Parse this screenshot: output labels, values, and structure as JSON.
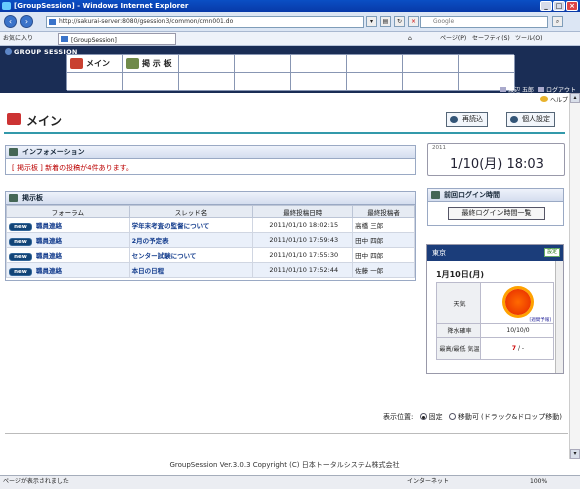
{
  "browser": {
    "window_title": "[GroupSession] - Windows Internet Explorer",
    "address": "http://sakurai-server:8080/gsession3/common/cmn001.do",
    "search_placeholder": "Google",
    "favorites_label": "お気に入り",
    "tab_title": "[GroupSession]",
    "toolbar_page": "ページ(P)",
    "toolbar_safety": "セーフティ(S)",
    "toolbar_tools": "ツール(O)",
    "status_text": "ページが表示されました",
    "zone": "インターネット",
    "zoom": "100%"
  },
  "header": {
    "logo": "GROUP SESSION",
    "menu": [
      {
        "label": "メイン",
        "icon": "main-icon"
      },
      {
        "label": "掲 示 板",
        "icon": "bbs-icon"
      }
    ],
    "user_name": "渡辺 五郎",
    "logout_label": "ログアウト",
    "help_label": "ヘルプ"
  },
  "page": {
    "title": "メイン",
    "reload_label": "再読込",
    "personal_settings_label": "個人設定"
  },
  "info": {
    "title": "インフォメーション",
    "message": "[ 掲示板 ] 新着の投稿が4件あります。"
  },
  "date_widget": {
    "year": "2011",
    "date_time": "1/10(月) 18:03"
  },
  "bbs": {
    "title": "掲示板",
    "columns": [
      "フォーラム",
      "スレッド名",
      "最終投稿日時",
      "最終投稿者"
    ],
    "new_badge": "new",
    "rows": [
      {
        "forum": "職員連絡",
        "thread": "学年末考査の監督について",
        "datetime": "2011/01/10 18:02:15",
        "author": "高橋 三郎"
      },
      {
        "forum": "職員連絡",
        "thread": "2月の予定表",
        "datetime": "2011/01/10 17:59:43",
        "author": "田中 四郎"
      },
      {
        "forum": "職員連絡",
        "thread": "センター試験について",
        "datetime": "2011/01/10 17:55:30",
        "author": "田中 四郎"
      },
      {
        "forum": "職員連絡",
        "thread": "本日の日程",
        "datetime": "2011/01/10 17:52:44",
        "author": "佐藤 一郎"
      }
    ]
  },
  "last_login": {
    "title": "前回ログイン時間",
    "button_label": "最終ログイン時間一覧"
  },
  "weather": {
    "city": "東京",
    "settings_label": "設定",
    "date": "1月10日(月)",
    "weather_label": "天気",
    "forecast_link": "[週間予報]",
    "rain_label": "降水確率",
    "rain_value": "10/10/0",
    "temp_label": "最高/最低 気温",
    "temp_high": "7",
    "temp_sep": "/ -"
  },
  "position": {
    "label": "表示位置:",
    "fixed": "固定",
    "movable": "移動可 (ドラック&ドロップ移動)"
  },
  "footer": {
    "copyright": "GroupSession Ver.3.0.3 Copyright (C) 日本トータルシステム株式会社"
  }
}
